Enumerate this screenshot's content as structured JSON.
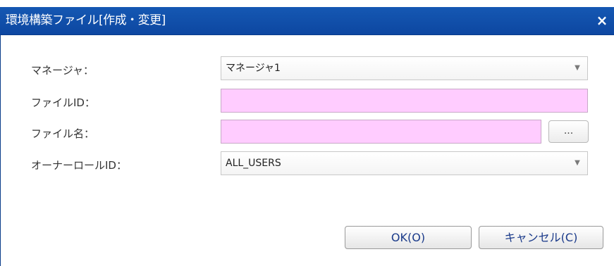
{
  "dialog": {
    "title": "環境構築ファイル[作成・変更]",
    "close_glyph": "×"
  },
  "form": {
    "manager": {
      "label": "マネージャ：",
      "value": "マネージャ1"
    },
    "file_id": {
      "label": "ファイルID：",
      "value": ""
    },
    "file_name": {
      "label": "ファイル名：",
      "value": "",
      "browse_label": "..."
    },
    "owner_role_id": {
      "label": "オーナーロールID：",
      "value": "ALL_USERS"
    }
  },
  "buttons": {
    "ok_label": "OK(O)",
    "cancel_label": "キャンセル(C)"
  },
  "colors": {
    "titlebar": "#0d47a1",
    "required_field": "#ffccff"
  }
}
